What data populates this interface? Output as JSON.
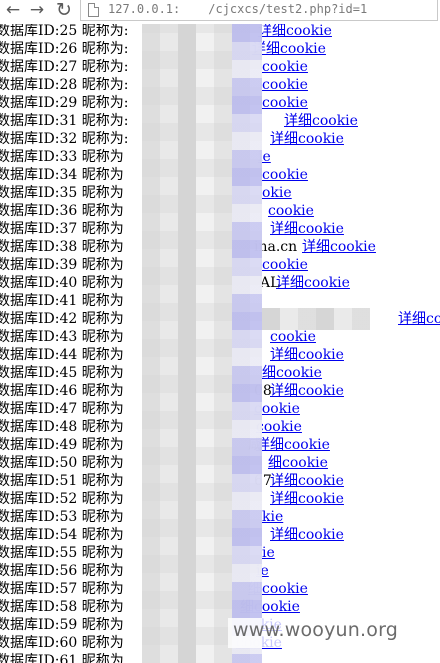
{
  "browser": {
    "url_host": "127.0.0.1:",
    "url_path": "/cjcxcs/test2.php?id=1",
    "back_glyph": "←",
    "forward_glyph": "→",
    "reload_glyph": "↻"
  },
  "rows": [
    {
      "label": "数据库ID:25 昵称为:",
      "link": "详细cookie"
    },
    {
      "label": "数据库ID:26 昵称为:",
      "link": "详细cookie"
    },
    {
      "label": "数据库ID:27 昵称为:",
      "link": "cookie"
    },
    {
      "label": "数据库ID:28 昵称为:",
      "link": "cookie"
    },
    {
      "label": "数据库ID:29 昵称为:",
      "link": "cookie"
    },
    {
      "label": "数据库ID:31 昵称为:",
      "link": "详细cookie"
    },
    {
      "label": "数据库ID:32 昵称为:",
      "link": "详细cookie"
    },
    {
      "label": "数据库ID:33 昵称为",
      "link": "ie"
    },
    {
      "label": "数据库ID:34 昵称为",
      "link": "cookie"
    },
    {
      "label": "数据库ID:35 昵称为",
      "link": "okie"
    },
    {
      "label": "数据库ID:36 昵称为",
      "link": "cookie"
    },
    {
      "label": "数据库ID:37 昵称为",
      "link": "详细cookie"
    },
    {
      "label": "数据库ID:38 昵称为",
      "pre": "ina.cn",
      "link": "详细cookie"
    },
    {
      "label": "数据库ID:39 昵称为",
      "link": "cookie"
    },
    {
      "label": "数据库ID:40 昵称为",
      "pre": "AL",
      "link": "详细cookie"
    },
    {
      "label": "数据库ID:41 昵称为",
      "link": ""
    },
    {
      "label": "数据库ID:42 昵称为",
      "link": "详细co"
    },
    {
      "label": "数据库ID:43 昵称为",
      "link": "cookie"
    },
    {
      "label": "数据库ID:44 昵称为",
      "link": "详细cookie"
    },
    {
      "label": "数据库ID:45 昵称为",
      "link": "细cookie"
    },
    {
      "label": "数据库ID:46 昵称为",
      "pre": "08",
      "link": "详细cookie"
    },
    {
      "label": "数据库ID:47 昵称为",
      "link": "cookie"
    },
    {
      "label": "数据库ID:48 昵称为",
      "link": "cookie"
    },
    {
      "label": "数据库ID:49 昵称为",
      "pre": "咸",
      "link": "详细cookie"
    },
    {
      "label": "数据库ID:50 昵称为",
      "link": "细cookie"
    },
    {
      "label": "数据库ID:51 昵称为",
      "pre": "67",
      "link": "详细cookie"
    },
    {
      "label": "数据库ID:52 昵称为",
      "link": "详细cookie"
    },
    {
      "label": "数据库ID:53 昵称为",
      "link": "kie"
    },
    {
      "label": "数据库ID:54 昵称为",
      "link": "详细cookie"
    },
    {
      "label": "数据库ID:55 昵称为",
      "link": "ie"
    },
    {
      "label": "数据库ID:56 昵称为",
      "link": "ie"
    },
    {
      "label": "数据库ID:57 昵称为",
      "link": "细cookie"
    },
    {
      "label": "数据库ID:58 昵称为",
      "link": "细cookie"
    },
    {
      "label": "数据库ID:59 昵称为",
      "link": "cookie"
    },
    {
      "label": "数据库ID:60 昵称为",
      "link": "cookie"
    },
    {
      "label": "数据库ID:61 昵称为",
      "link": ""
    }
  ],
  "watermark": "www.wooyun.org"
}
